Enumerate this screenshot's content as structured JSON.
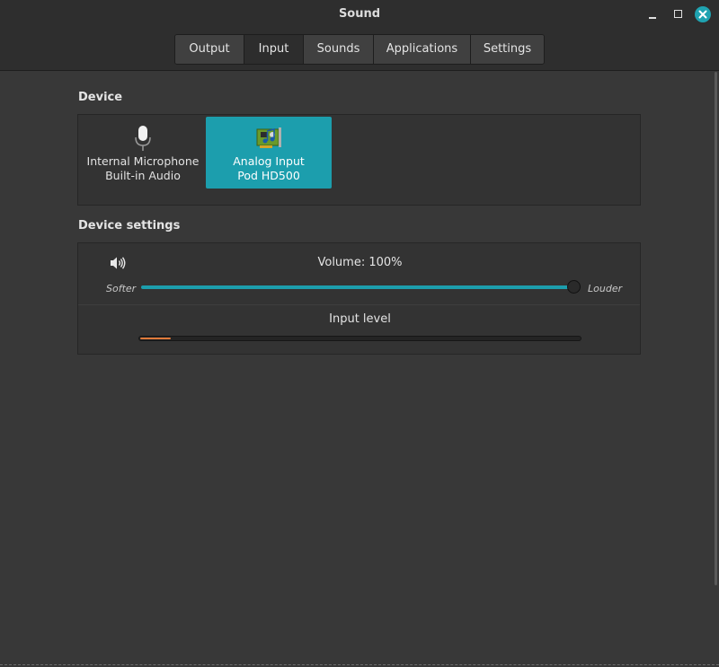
{
  "window": {
    "title": "Sound"
  },
  "tabs": [
    {
      "label": "Output",
      "active": false
    },
    {
      "label": "Input",
      "active": true
    },
    {
      "label": "Sounds",
      "active": false
    },
    {
      "label": "Applications",
      "active": false
    },
    {
      "label": "Settings",
      "active": false
    }
  ],
  "device": {
    "heading": "Device",
    "items": [
      {
        "name": "Internal Microphone",
        "sub": "Built-in Audio",
        "icon": "microphone-icon",
        "selected": false
      },
      {
        "name": "Analog Input",
        "sub": "Pod HD500",
        "icon": "sound-card-icon",
        "selected": true
      }
    ]
  },
  "settings": {
    "heading": "Device settings",
    "volume_label": "Volume: 100%",
    "volume_value": 100,
    "softer": "Softer",
    "louder": "Louder",
    "input_level_label": "Input level",
    "input_level_value": 0.07
  },
  "colors": {
    "accent": "#1c9ead",
    "level": "#e07a3a",
    "close": "#1fa3b1"
  }
}
